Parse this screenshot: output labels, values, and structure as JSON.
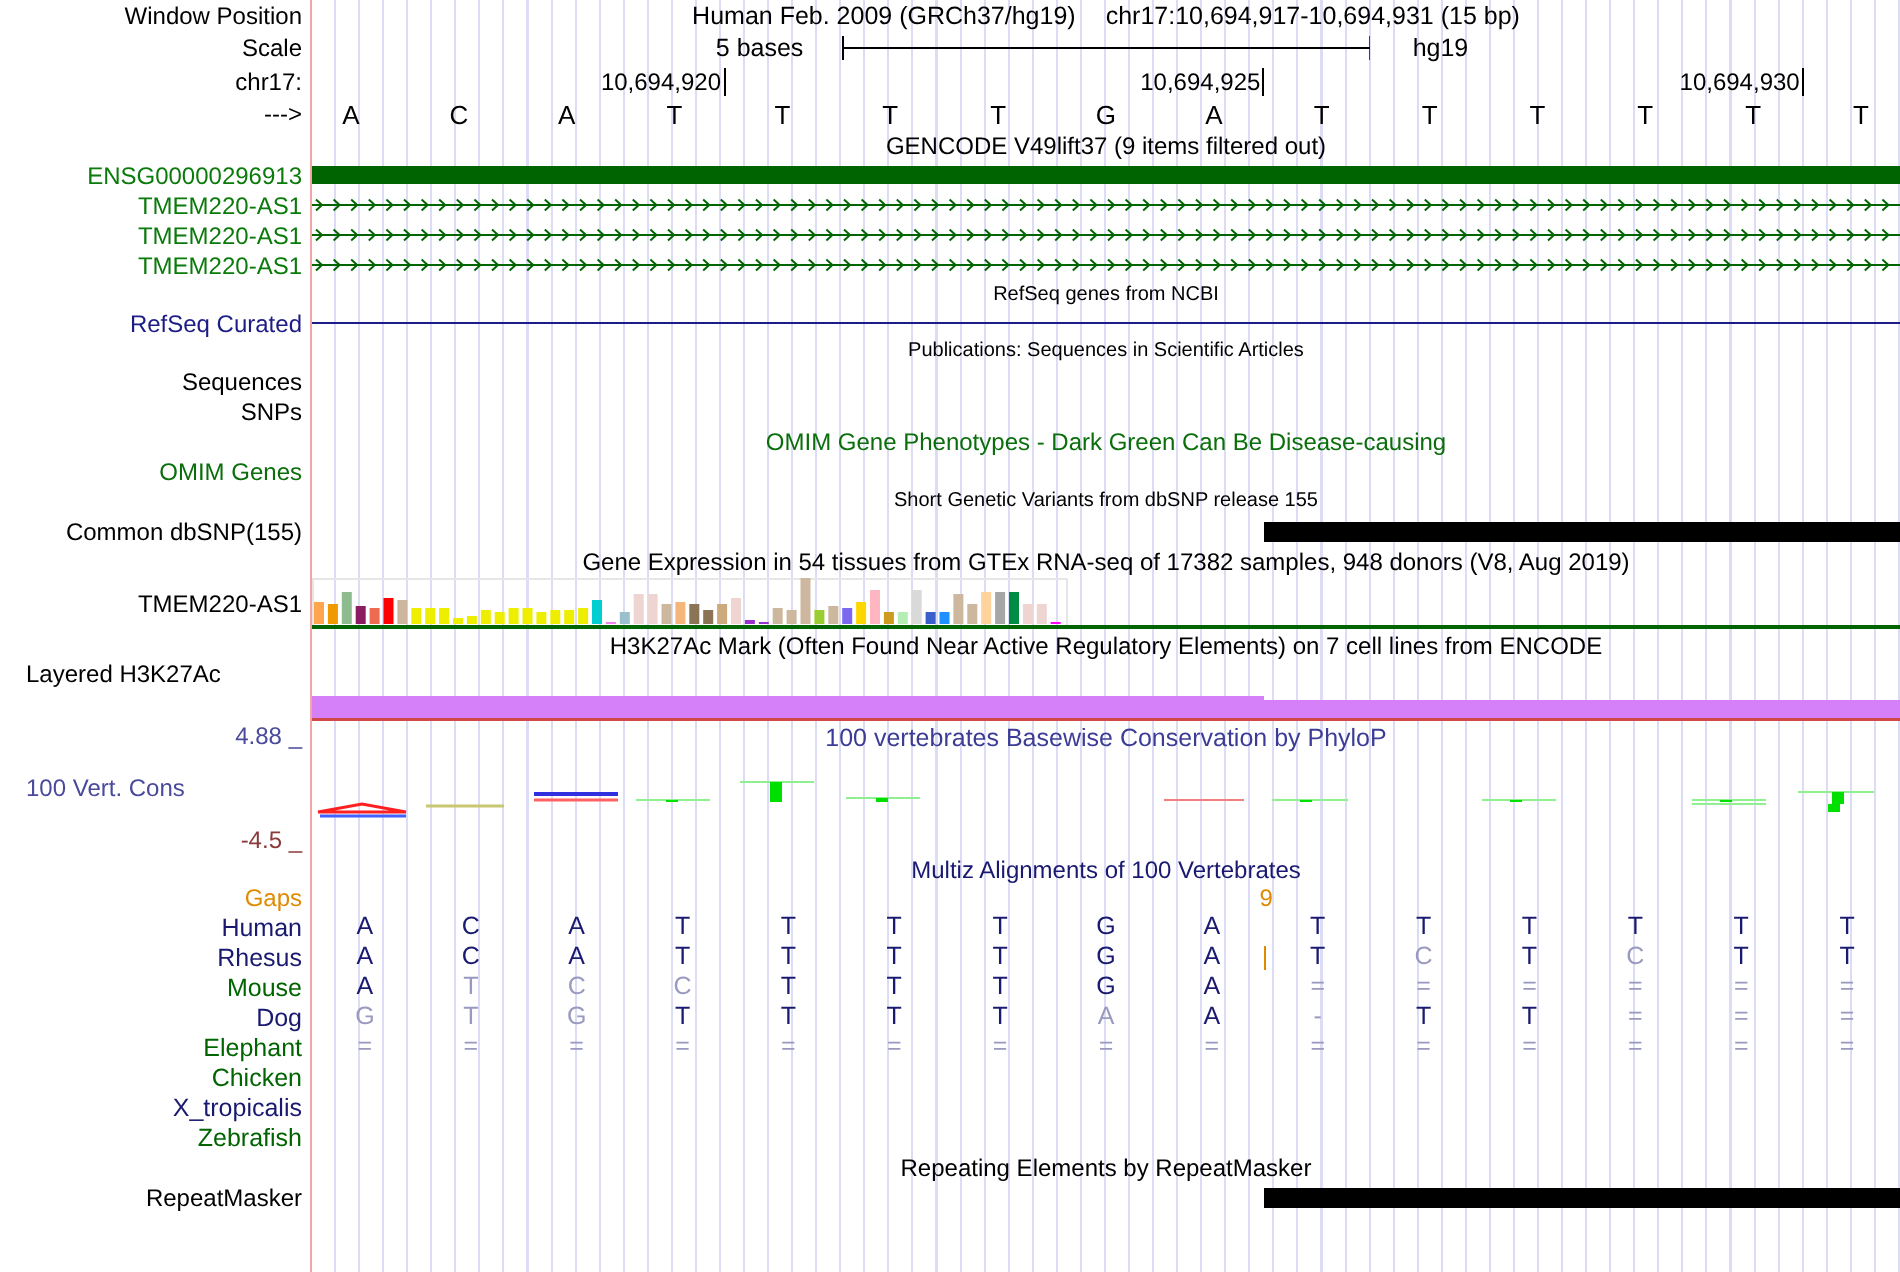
{
  "header": {
    "window_label": "Window Position",
    "assembly": "Human Feb. 2009 (GRCh37/hg19)",
    "position": "chr17:10,694,917-10,694,931 (15 bp)",
    "scale_label": "Scale",
    "scale_text": "5 bases",
    "scale_db": "hg19",
    "chrom_label": "chr17:",
    "ticks": [
      "10,694,920",
      "10,694,925",
      "10,694,930"
    ],
    "strand_label": "--->",
    "bases": [
      "A",
      "C",
      "A",
      "T",
      "T",
      "T",
      "T",
      "G",
      "A",
      "T",
      "T",
      "T",
      "T",
      "T",
      "T"
    ]
  },
  "tracks": [
    {
      "kind": "genes",
      "title": "GENCODE V49lift37 (9 items filtered out)",
      "items": [
        {
          "label": "ENSG00000296913",
          "kind": "block"
        },
        {
          "label": "TMEM220-AS1",
          "kind": "intron"
        },
        {
          "label": "TMEM220-AS1",
          "kind": "intron"
        },
        {
          "label": "TMEM220-AS1",
          "kind": "intron"
        }
      ]
    },
    {
      "kind": "refseq",
      "title": "RefSeq genes from NCBI",
      "items": [
        {
          "label": "RefSeq Curated",
          "kind": "line"
        }
      ]
    },
    {
      "kind": "pubs",
      "title": "Publications: Sequences in Scientific Articles",
      "items": [
        {
          "label": "Sequences",
          "kind": "empty"
        },
        {
          "label": "SNPs",
          "kind": "empty"
        }
      ]
    },
    {
      "kind": "omim",
      "title": "OMIM Gene Phenotypes - Dark Green Can Be Disease-causing",
      "items": [
        {
          "label": "OMIM Genes",
          "kind": "empty"
        }
      ]
    },
    {
      "kind": "dbsnp",
      "title": "Short Genetic Variants from dbSNP release 155",
      "items": [
        {
          "label": "Common dbSNP(155)",
          "kind": "partial"
        }
      ]
    },
    {
      "kind": "gtex",
      "title": "Gene Expression in 54 tissues from GTEx RNA-seq of 17382 samples, 948 donors (V8, Aug 2019)",
      "items": [
        {
          "label": "TMEM220-AS1",
          "kind": "barchart"
        }
      ]
    },
    {
      "kind": "h3k27ac",
      "title": "H3K27Ac Mark (Often Found Near Active Regulatory Elements) on 7 cell lines from ENCODE",
      "items": [
        {
          "label": "Layered H3K27Ac",
          "kind": "layered"
        }
      ]
    },
    {
      "kind": "phylop",
      "title": "100 vertebrates Basewise Conservation by PhyloP",
      "items": [
        {
          "label": "100 Vert. Cons",
          "kind": "wiggle",
          "ymax": "4.88 _",
          "ymin": "-4.5 _"
        }
      ]
    },
    {
      "kind": "multiz",
      "title": "Multiz Alignments of 100 Vertebrates",
      "gaps": {
        "label": "Gaps",
        "cells": [
          {},
          {},
          {},
          {},
          {},
          {},
          {},
          {},
          {
            "insert": "9"
          },
          {},
          {},
          {},
          {},
          {},
          {}
        ]
      },
      "species": [
        {
          "label": "Human",
          "color": "#191970",
          "cells": [
            {
              "base": "A",
              "match": true
            },
            {
              "base": "C",
              "match": true
            },
            {
              "base": "A",
              "match": true
            },
            {
              "base": "T",
              "match": true
            },
            {
              "base": "T",
              "match": true
            },
            {
              "base": "T",
              "match": true
            },
            {
              "base": "T",
              "match": true
            },
            {
              "base": "G",
              "match": true
            },
            {
              "base": "A",
              "match": true
            },
            {
              "base": "T",
              "match": true
            },
            {
              "base": "T",
              "match": true
            },
            {
              "base": "T",
              "match": true
            },
            {
              "base": "T",
              "match": true
            },
            {
              "base": "T",
              "match": true
            },
            {
              "base": "T",
              "match": true
            }
          ]
        },
        {
          "label": "Rhesus",
          "color": "#191970",
          "cells": [
            {
              "base": "A",
              "match": true
            },
            {
              "base": "C",
              "match": true
            },
            {
              "base": "A",
              "match": true
            },
            {
              "base": "T",
              "match": true
            },
            {
              "base": "T",
              "match": true
            },
            {
              "base": "T",
              "match": true
            },
            {
              "base": "T",
              "match": true
            },
            {
              "base": "G",
              "match": true
            },
            {
              "base": "A",
              "match": true,
              "insert": true
            },
            {
              "base": "T",
              "match": true
            },
            {
              "base": "C",
              "match": false
            },
            {
              "base": "T",
              "match": true
            },
            {
              "base": "C",
              "match": false
            },
            {
              "base": "T",
              "match": true
            },
            {
              "base": "T",
              "match": true
            }
          ]
        },
        {
          "label": "Mouse",
          "color": "#006400",
          "cells": [
            {
              "base": "A",
              "match": true
            },
            {
              "base": "T",
              "match": false
            },
            {
              "base": "C",
              "match": false
            },
            {
              "base": "C",
              "match": false
            },
            {
              "base": "T",
              "match": true
            },
            {
              "base": "T",
              "match": true
            },
            {
              "base": "T",
              "match": true
            },
            {
              "base": "G",
              "match": true
            },
            {
              "base": "A",
              "match": true
            },
            {
              "base": "=",
              "match": false
            },
            {
              "base": "=",
              "match": false
            },
            {
              "base": "=",
              "match": false
            },
            {
              "base": "=",
              "match": false
            },
            {
              "base": "=",
              "match": false
            },
            {
              "base": "=",
              "match": false
            }
          ]
        },
        {
          "label": "Dog",
          "color": "#191970",
          "cells": [
            {
              "base": "G",
              "match": false
            },
            {
              "base": "T",
              "match": false
            },
            {
              "base": "G",
              "match": false
            },
            {
              "base": "T",
              "match": true
            },
            {
              "base": "T",
              "match": true
            },
            {
              "base": "T",
              "match": true
            },
            {
              "base": "T",
              "match": true
            },
            {
              "base": "A",
              "match": false
            },
            {
              "base": "A",
              "match": true
            },
            {
              "base": "-",
              "match": false
            },
            {
              "base": "T",
              "match": true
            },
            {
              "base": "T",
              "match": true
            },
            {
              "base": "=",
              "match": false
            },
            {
              "base": "=",
              "match": false
            },
            {
              "base": "=",
              "match": false
            }
          ]
        },
        {
          "label": "Elephant",
          "color": "#006400",
          "cells": [
            {
              "base": "=",
              "match": false
            },
            {
              "base": "=",
              "match": false
            },
            {
              "base": "=",
              "match": false
            },
            {
              "base": "=",
              "match": false
            },
            {
              "base": "=",
              "match": false
            },
            {
              "base": "=",
              "match": false
            },
            {
              "base": "=",
              "match": false
            },
            {
              "base": "=",
              "match": false
            },
            {
              "base": "=",
              "match": false
            },
            {
              "base": "=",
              "match": false
            },
            {
              "base": "=",
              "match": false
            },
            {
              "base": "=",
              "match": false
            },
            {
              "base": "=",
              "match": false
            },
            {
              "base": "=",
              "match": false
            },
            {
              "base": "=",
              "match": false
            }
          ]
        },
        {
          "label": "Chicken",
          "color": "#006400"
        },
        {
          "label": "X_tropicalis",
          "color": "#191970"
        },
        {
          "label": "Zebrafish",
          "color": "#006400"
        }
      ]
    },
    {
      "kind": "repeats",
      "title": "Repeating Elements by RepeatMasker",
      "items": [
        {
          "label": "RepeatMasker",
          "kind": "partial"
        }
      ]
    }
  ]
}
